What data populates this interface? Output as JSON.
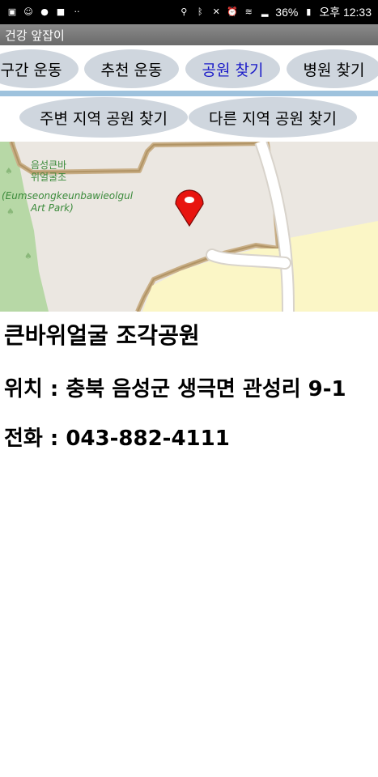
{
  "status_bar": {
    "left_icons": [
      "media-icon",
      "face-icon",
      "talk-icon",
      "message-icon",
      "more-icon"
    ],
    "battery_percent": "36%",
    "time": "오후 12:33"
  },
  "app": {
    "title": "건강 앞잡이"
  },
  "tabs": [
    {
      "label": "구간 운동",
      "active": false
    },
    {
      "label": "추천 운동",
      "active": false
    },
    {
      "label": "공원 찾기",
      "active": true
    },
    {
      "label": "병원 찾기",
      "active": false
    }
  ],
  "subtabs": [
    {
      "label": "주변 지역 공원 찾기"
    },
    {
      "label": "다른 지역 공원 찾기"
    }
  ],
  "map": {
    "place_label_ko_line1": "음성큰바",
    "place_label_ko_line2": "위얼굴조",
    "place_label_en_line1": "(Eumseongkeunbawieolgul",
    "place_label_en_line2": "Art Park)",
    "marker_color": "#e8140f"
  },
  "place": {
    "name": "큰바위얼굴 조각공원",
    "location": "위치 : 충북 음성군 생극면 관성리 9-1",
    "phone": "전화 : 043-882-4111"
  },
  "colors": {
    "tab_bg": "#cfd6de",
    "active_tab_text": "#1a1ac8",
    "divider": "#9ec2dd",
    "app_bar": "#7a7a7a"
  }
}
